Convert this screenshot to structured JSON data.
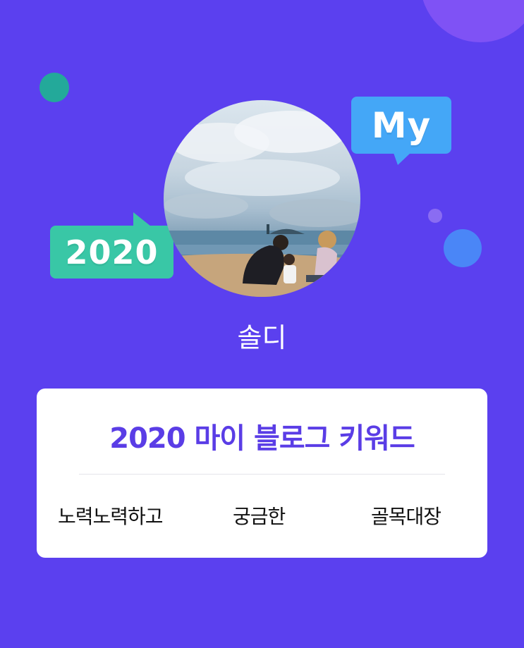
{
  "colors": {
    "background": "#5b40ef",
    "deco_topright": "#7f52f5",
    "deco_teal": "#23a99a",
    "deco_small": "#8a6cf2",
    "deco_blue": "#4a86f7",
    "bubble_my": "#44a7f7",
    "bubble_2020": "#39c7a6",
    "card_title": "#5a3de6",
    "username": "#ffffff"
  },
  "bubbles": {
    "my": "My",
    "year": "2020"
  },
  "profile": {
    "avatar_icon": "profile-photo-beach-family",
    "name": "솔디"
  },
  "card": {
    "title": "2020 마이 블로그 키워드",
    "keywords": [
      "노력노력하고",
      "궁금한",
      "골목대장"
    ]
  }
}
